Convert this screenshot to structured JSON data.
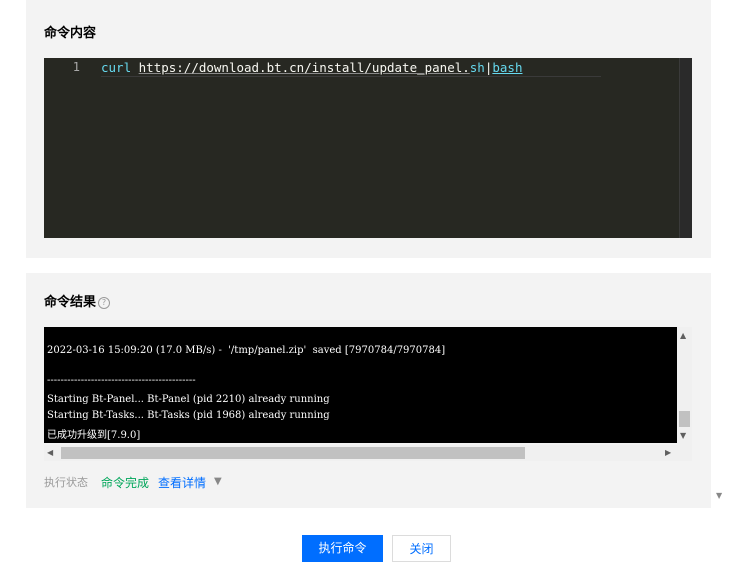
{
  "command_panel": {
    "title": "命令内容",
    "editor": {
      "line_number": "1",
      "tokens": {
        "cmd": "curl",
        "space": " ",
        "url": "https://download.bt.cn/install/update_panel.",
        "ext": "sh",
        "pipe": "|",
        "bash": "bash"
      }
    }
  },
  "result_panel": {
    "title": "命令结果",
    "help_icon": "?",
    "output_lines": [
      "2022-03-16 15:09:20 (17.0 MB/s) -  '/tmp/panel.zip'  saved [7970784/7970784]",
      "",
      "--------------------------------------------",
      "Starting Bt-Panel... Bt-Panel (pid 2210) already running",
      "Starting Bt-Tasks... Bt-Tasks (pid 1968) already running",
      "已成功升级到[7.9.0]"
    ],
    "status": {
      "label": "执行状态",
      "value": "命令完成",
      "details_link": "查看详情",
      "details_caret": "▼"
    }
  },
  "footer": {
    "execute_button": "执行命令",
    "close_button": "关闭"
  },
  "scrollbar_arrows": {
    "up": "▲",
    "down": "▼",
    "left": "◀",
    "right": "▶"
  },
  "colors": {
    "accent": "#006eff",
    "success": "#00a65a",
    "editor_bg": "#272822",
    "terminal_bg": "#000000"
  }
}
